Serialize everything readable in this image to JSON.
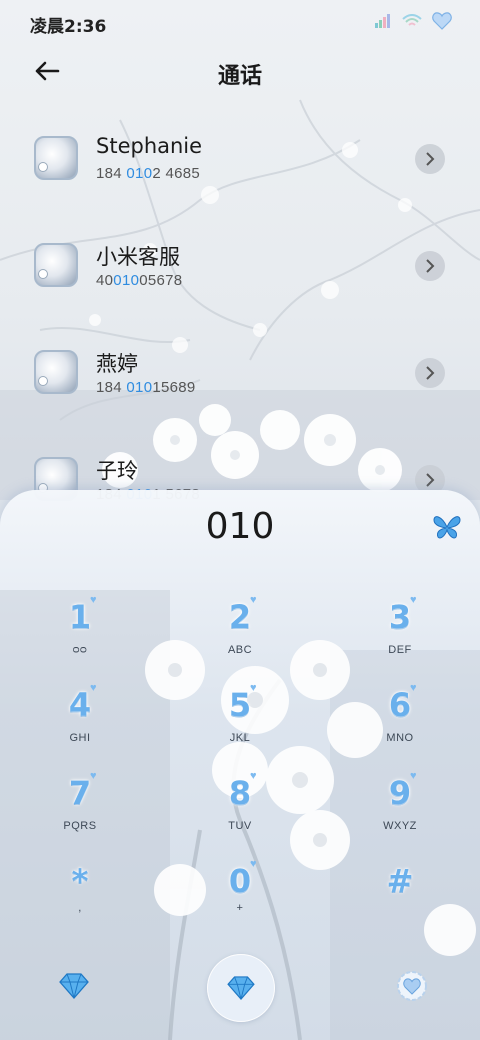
{
  "status_bar": {
    "time": "凌晨2:36"
  },
  "header": {
    "title": "通话"
  },
  "contacts": [
    {
      "name": "Stephanie",
      "number_pre": "184 ",
      "number_hl": "010",
      "number_post": "2 4685"
    },
    {
      "name": "小米客服",
      "number_pre": "40",
      "number_hl": "010",
      "number_post": "05678"
    },
    {
      "name": "燕婷",
      "number_pre": "184 ",
      "number_hl": "010",
      "number_post": "15689"
    },
    {
      "name": "子玲",
      "number_pre": "184 ",
      "number_hl": "010",
      "number_post": "1 5678"
    }
  ],
  "dialer": {
    "typed_number": "010",
    "keys": [
      {
        "digit": "1",
        "letters": "ᴑᴑ"
      },
      {
        "digit": "2",
        "letters": "ABC"
      },
      {
        "digit": "3",
        "letters": "DEF"
      },
      {
        "digit": "4",
        "letters": "GHI"
      },
      {
        "digit": "5",
        "letters": "JKL"
      },
      {
        "digit": "6",
        "letters": "MNO"
      },
      {
        "digit": "7",
        "letters": "PQRS"
      },
      {
        "digit": "8",
        "letters": "TUV"
      },
      {
        "digit": "9",
        "letters": "WXYZ"
      },
      {
        "digit": "*",
        "letters": ","
      },
      {
        "digit": "0",
        "letters": "+"
      },
      {
        "digit": "#",
        "letters": ""
      }
    ]
  },
  "icons": {
    "back": "back-arrow-icon",
    "chevron": "chevron-right-icon",
    "butterfly": "butterfly-icon",
    "call": "diamond-call-icon",
    "left": "diamond-icon",
    "right": "heart-menu-icon"
  },
  "colors": {
    "accent": "#2f8ce0",
    "key_digit": "#6ab0ec"
  }
}
